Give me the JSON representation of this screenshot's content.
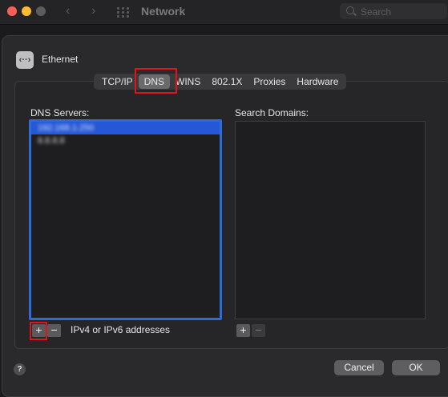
{
  "window": {
    "title": "Network",
    "search_placeholder": "Search",
    "back_icon": "chevron-left-icon",
    "forward_icon": "chevron-right-icon",
    "grid_icon": "grid-icon"
  },
  "interface": {
    "name": "Ethernet",
    "icon_glyph": "‹··›"
  },
  "tabs": [
    {
      "label": "TCP/IP"
    },
    {
      "label": "DNS",
      "active": true
    },
    {
      "label": "WINS"
    },
    {
      "label": "802.1X"
    },
    {
      "label": "Proxies"
    },
    {
      "label": "Hardware"
    }
  ],
  "dns": {
    "label": "DNS Servers:",
    "servers": [
      "192.168.1.250",
      "8.8.8.8"
    ],
    "add_symbol": "+",
    "remove_symbol": "−",
    "hint": "IPv4 or IPv6 addresses"
  },
  "search_domains": {
    "label": "Search Domains:",
    "add_symbol": "+",
    "remove_symbol": "−"
  },
  "footer": {
    "help_symbol": "?",
    "cancel_label": "Cancel",
    "ok_label": "OK"
  },
  "highlight_color": "#e0141c",
  "selection_color": "#2557d6"
}
